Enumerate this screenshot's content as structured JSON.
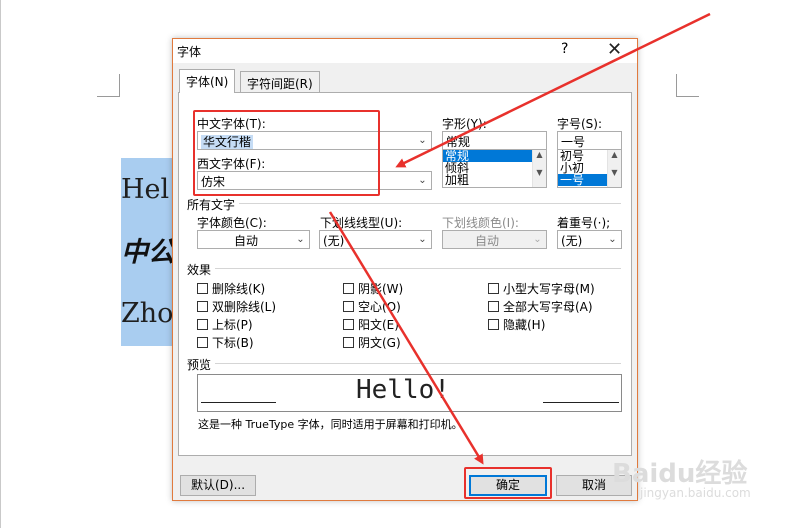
{
  "dialog": {
    "title": "字体",
    "help_label": "?",
    "close_label": "✕",
    "tabs": [
      {
        "label": "字体(N)",
        "active": true
      },
      {
        "label": "字符间距(R)",
        "active": false
      }
    ],
    "chinese_font": {
      "label": "中文字体(T):",
      "value": "华文行楷"
    },
    "western_font": {
      "label": "西文字体(F):",
      "value": "仿宋"
    },
    "style": {
      "label": "字形(Y):",
      "value": "常规",
      "options": [
        "常规",
        "倾斜",
        "加粗"
      ],
      "selected": "常规"
    },
    "size": {
      "label": "字号(S):",
      "value": "一号",
      "options": [
        "初号",
        "小初",
        "一号"
      ],
      "selected": "一号"
    },
    "all_text": {
      "title": "所有文字",
      "font_color": {
        "label": "字体颜色(C):",
        "value": "自动"
      },
      "underline_style": {
        "label": "下划线线型(U):",
        "value": "(无)"
      },
      "underline_color": {
        "label": "下划线颜色(I):",
        "value": "自动"
      },
      "emphasis": {
        "label": "着重号(·);",
        "value": "(无)"
      }
    },
    "effects": {
      "title": "效果",
      "items": [
        "删除线(K)",
        "双删除线(L)",
        "上标(P)",
        "下标(B)",
        "阴影(W)",
        "空心(O)",
        "阳文(E)",
        "阴文(G)",
        "小型大写字母(M)",
        "全部大写字母(A)",
        "隐藏(H)"
      ]
    },
    "preview": {
      "title": "预览",
      "sample": "Hello!",
      "note": "这是一种 TrueType 字体，同时适用于屏幕和打印机。"
    },
    "buttons": {
      "default_label": "默认(D)...",
      "ok_label": "确定",
      "cancel_label": "取消"
    }
  },
  "document": {
    "lines": [
      "Hel",
      "中公",
      "Zho"
    ]
  },
  "annotations": {
    "color": "#e8312c"
  },
  "watermark": {
    "brand": "Baidu经验",
    "url": "jingyan.baidu.com"
  }
}
